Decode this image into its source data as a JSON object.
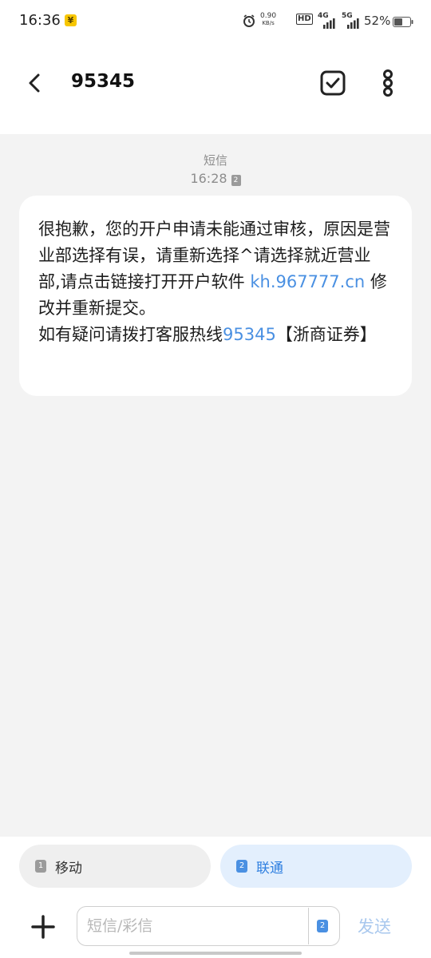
{
  "status_bar": {
    "time": "16:36",
    "app_icon_glyph": "¥",
    "net_speed_value": "0.90",
    "net_speed_unit": "KB/s",
    "hd_label": "HD",
    "sim1_network": "4G",
    "sim2_network": "5G",
    "battery_percent": "52%"
  },
  "header": {
    "title": "95345",
    "icons": {
      "back": "back-arrow-icon",
      "select": "checkbox-select-icon",
      "more": "more-vertical-icon"
    }
  },
  "conversation": {
    "message_type": "短信",
    "timestamp": "16:28",
    "sim_badge": "2",
    "message": {
      "text_part1": "很抱歉，您的开户申请未能通过审核，原因是营业部选择有误，请重新选择^请选择就近营业部,请点击链接打开开户软件 ",
      "link": "kh.967777.cn",
      "text_part2": " 修改并重新提交。",
      "text_part3": "如有疑问请拨打客服热线",
      "phone_link": "95345",
      "text_part4": "【浙商证券】"
    }
  },
  "sim_selector": {
    "sim1": {
      "number": "1",
      "label": "移动"
    },
    "sim2": {
      "number": "2",
      "label": "联通"
    }
  },
  "composer": {
    "placeholder": "短信/彩信",
    "sim_badge": "2",
    "send_label": "发送"
  },
  "colors": {
    "accent": "#4a90e2",
    "background": "#f3f3f3",
    "bubble": "#ffffff",
    "sim2_background": "#e3effd"
  }
}
